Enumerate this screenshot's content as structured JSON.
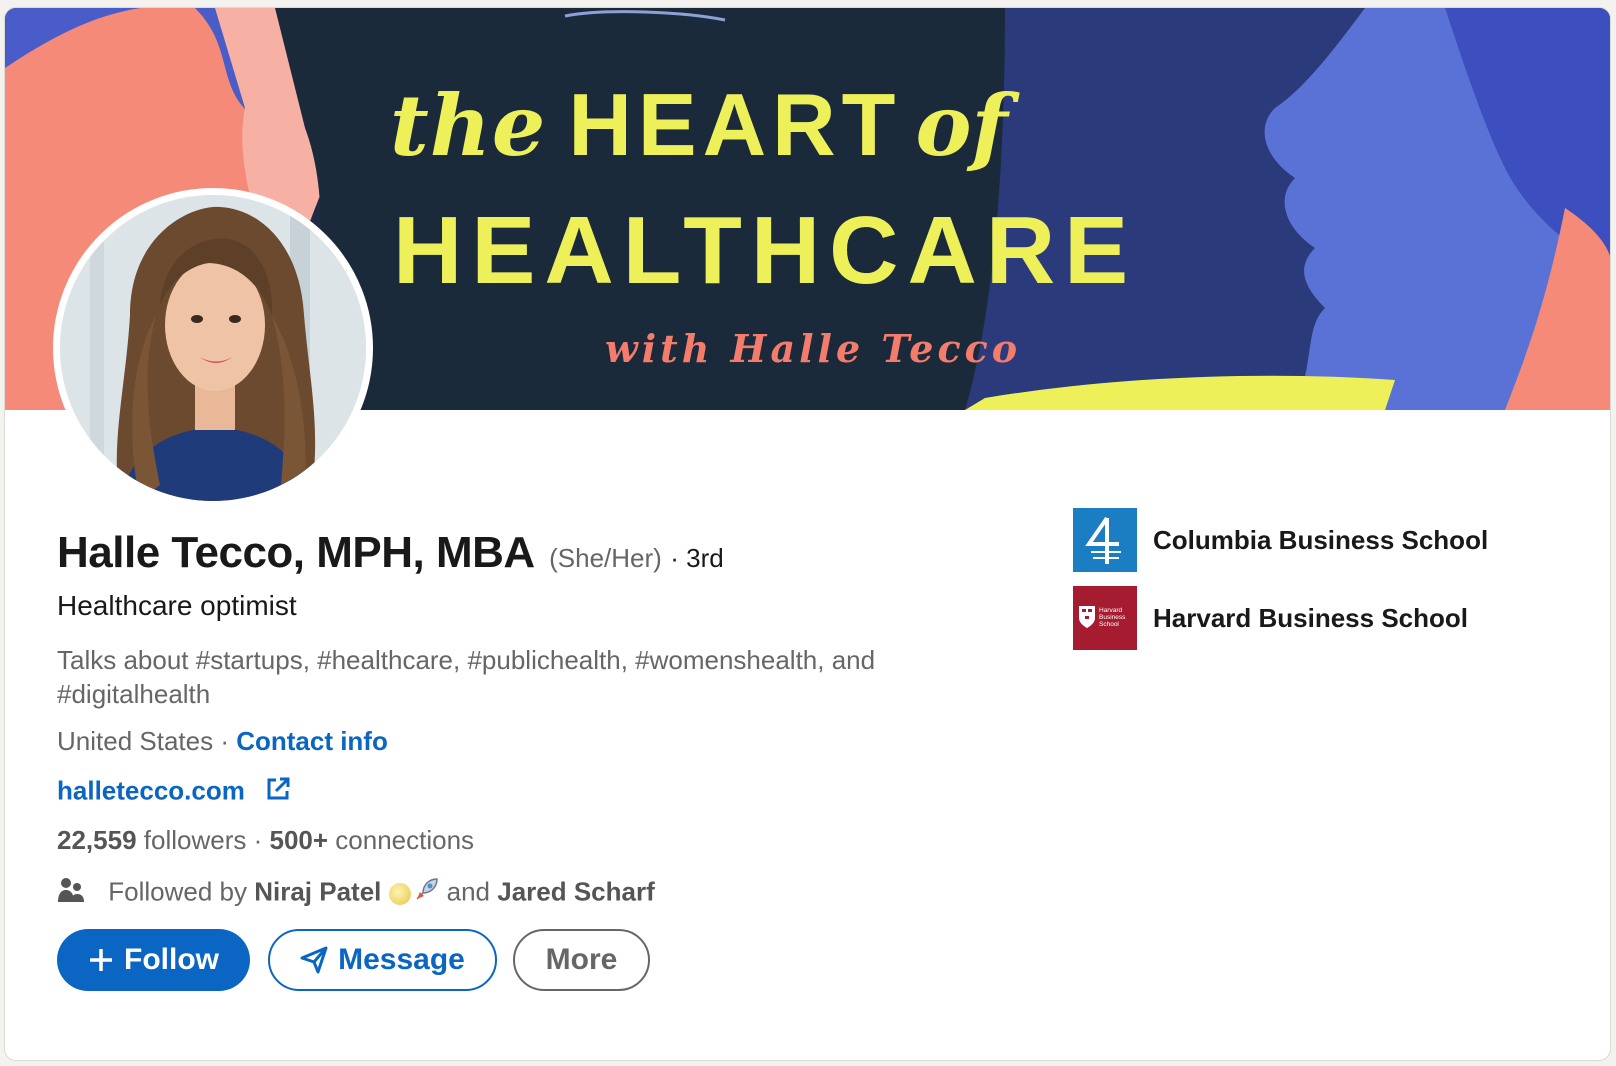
{
  "banner": {
    "line1_the": "the",
    "line1_heart": "HEART",
    "line1_of": "of",
    "line2": "HEALTHCARE",
    "line3": "with Halle Tecco"
  },
  "profile": {
    "name": "Halle Tecco, MPH, MBA",
    "pronouns": "(She/Her)",
    "degree": "· 3rd",
    "headline": "Healthcare optimist",
    "talks_about": "Talks about #startups, #healthcare, #publichealth, #womenshealth, and #digitalhealth",
    "location": "United States",
    "location_sep": " · ",
    "contact_info": "Contact info",
    "website": "halletecco.com",
    "followers_count": "22,559",
    "followers_label": "followers",
    "stats_sep": " · ",
    "connections_count": "500+",
    "connections_label": "connections",
    "followed_by_prefix": "Followed by",
    "follower_1": "Niraj Patel",
    "followed_by_and": "and",
    "follower_2": "Jared Scharf"
  },
  "actions": {
    "follow": "Follow",
    "message": "Message",
    "more": "More"
  },
  "education": [
    {
      "name": "Columbia Business School",
      "logo_icon": "columbia-logo",
      "color": "#1b7ec2"
    },
    {
      "name": "Harvard Business School",
      "logo_icon": "harvard-logo",
      "color": "#a51c30",
      "logo_text": "Harvard Business School"
    }
  ],
  "colors": {
    "accent": "#0a66c2",
    "banner_yellow": "#eef05a",
    "banner_coral": "#f47c6c",
    "banner_navy": "#1e2a44"
  }
}
